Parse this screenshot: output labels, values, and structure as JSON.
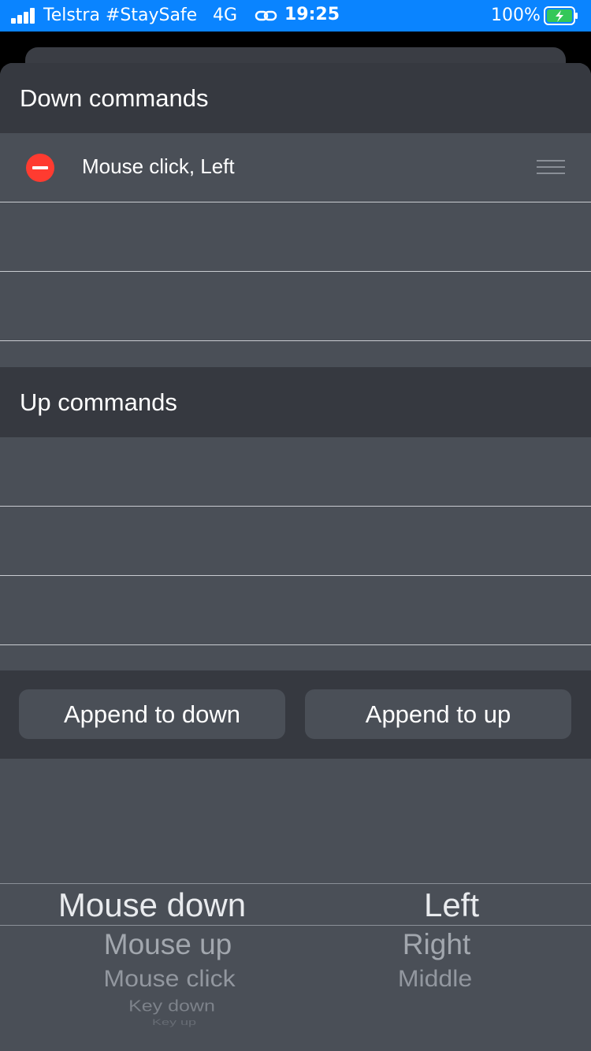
{
  "status_bar": {
    "carrier": "Telstra #StaySafe",
    "network": "4G",
    "time": "19:25",
    "battery_percent": "100%",
    "icons": [
      "signal-icon",
      "link-icon",
      "battery-charging-icon"
    ],
    "background_color": "#0a84ff"
  },
  "down_section": {
    "title": "Down commands",
    "items": [
      {
        "label": "Mouse click, Left"
      }
    ]
  },
  "up_section": {
    "title": "Up commands",
    "items": []
  },
  "actions": {
    "append_down": "Append to down",
    "append_up": "Append to up"
  },
  "picker": {
    "command_options": [
      "Mouse down",
      "Mouse up",
      "Mouse click",
      "Key down",
      "Key up"
    ],
    "button_options": [
      "Left",
      "Right",
      "Middle"
    ],
    "selected_command": "Mouse down",
    "selected_button": "Left"
  },
  "colors": {
    "delete": "#ff3b30",
    "sheet": "#4a4f57",
    "header": "#363940"
  }
}
